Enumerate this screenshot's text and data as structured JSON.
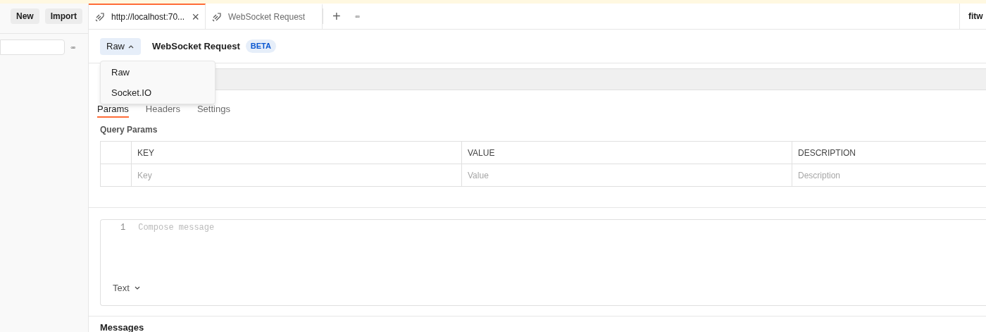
{
  "sidebar": {
    "buttons": [
      "New",
      "Import"
    ],
    "more": "◦◦◦"
  },
  "tabs": [
    {
      "label": "http://localhost:70...",
      "selected": true,
      "close": "×"
    },
    {
      "label": "WebSocket Request",
      "selected": false
    }
  ],
  "tab_actions": {
    "add": "+",
    "more": "◦◦◦"
  },
  "workspace": {
    "label": "fitw"
  },
  "request": {
    "mode": "Raw",
    "title": "WebSocket Request",
    "badge": "BETA",
    "menu_open": true,
    "menu": [
      {
        "label": "Raw"
      },
      {
        "label": "Socket.IO"
      }
    ]
  },
  "sub_tabs": [
    {
      "label": "Params",
      "selected": true
    },
    {
      "label": "Headers",
      "selected": false
    },
    {
      "label": "Settings",
      "selected": false
    }
  ],
  "params": {
    "title": "Query Params",
    "columns": [
      "KEY",
      "VALUE",
      "DESCRIPTION"
    ],
    "placeholders": [
      "Key",
      "Value",
      "Description"
    ]
  },
  "composer": {
    "line_number": "1",
    "placeholder": "Compose message",
    "format": "Text"
  },
  "messages": {
    "title": "Messages"
  }
}
